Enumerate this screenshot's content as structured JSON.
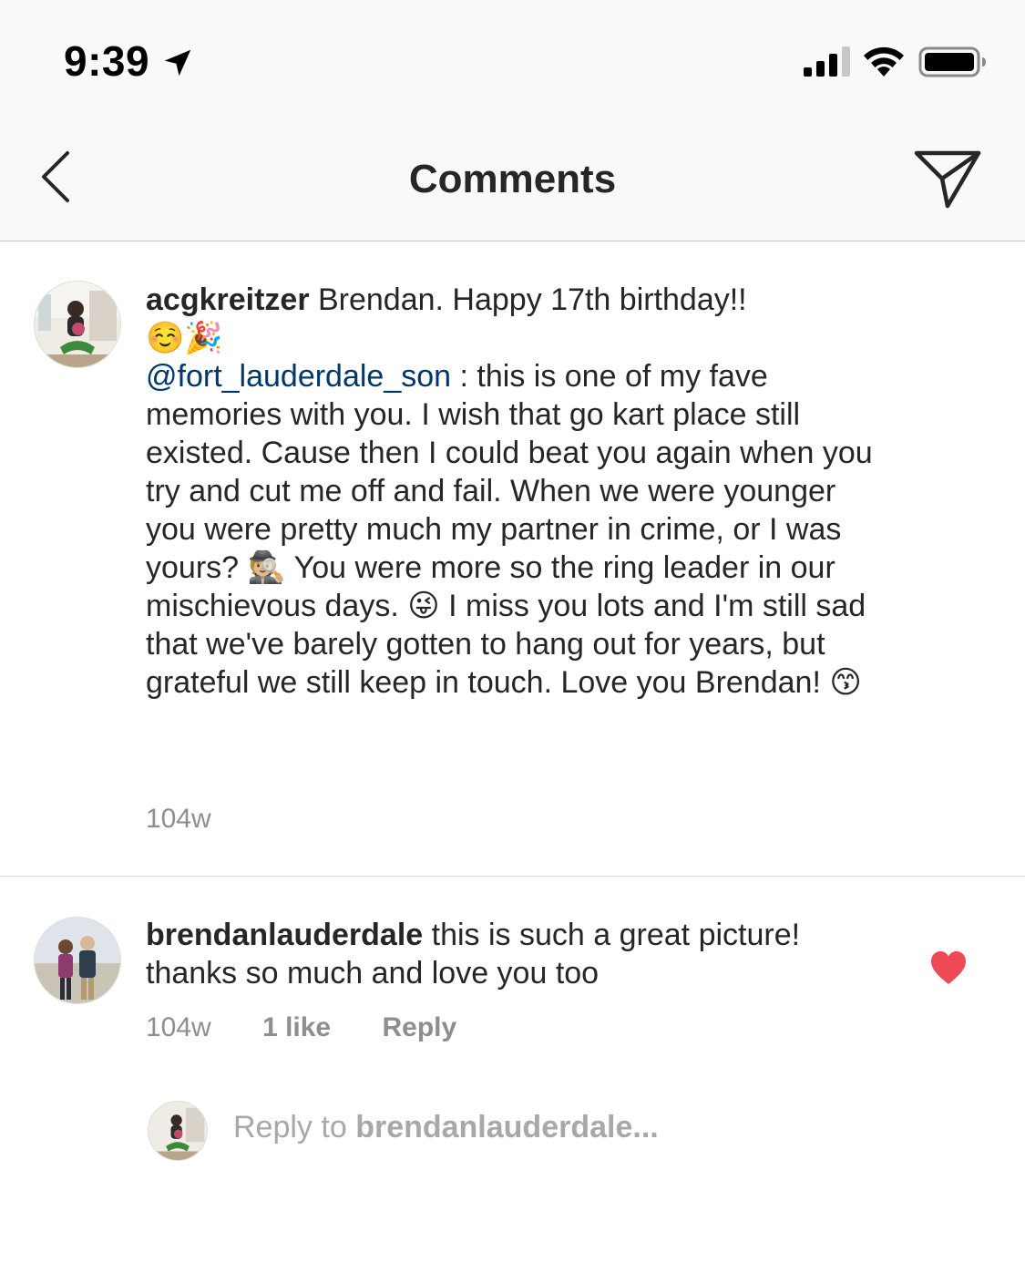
{
  "status_bar": {
    "time": "9:39"
  },
  "nav": {
    "title": "Comments"
  },
  "comments": [
    {
      "username": "acgkreitzer",
      "text_first": " Brendan. Happy 17th birthday!!",
      "emoji_line": "☺️🎉",
      "mention": "@fort_lauderdale_son",
      "text_main_1": " : this is one of my fave memories with you. I wish that go kart place still existed. Cause then I could beat you again when you try and cut me off and fail. When we were younger you were pretty much my partner in crime, or I was yours? ",
      "emoji_detective": "🕵🏼",
      "text_main_2": " You were more so the ring leader in our mischievous days. ",
      "emoji_wink": "😜",
      "text_main_3": " I miss you lots and I'm still sad that we've barely gotten to hang out for years, but grateful we still keep in touch. Love you Brendan! ",
      "emoji_kiss": "😙",
      "time": "104w"
    },
    {
      "username": "brendanlauderdale",
      "text": " this is such a great picture! thanks so much and love you too",
      "time": "104w",
      "likes": "1 like",
      "reply_label": "Reply",
      "liked": true
    }
  ],
  "reply_box": {
    "prefix": "Reply to ",
    "target": "brendanlauderdale..."
  },
  "colors": {
    "heart": "#ed4956",
    "mention": "#00376b",
    "meta": "#8e8e8e"
  }
}
